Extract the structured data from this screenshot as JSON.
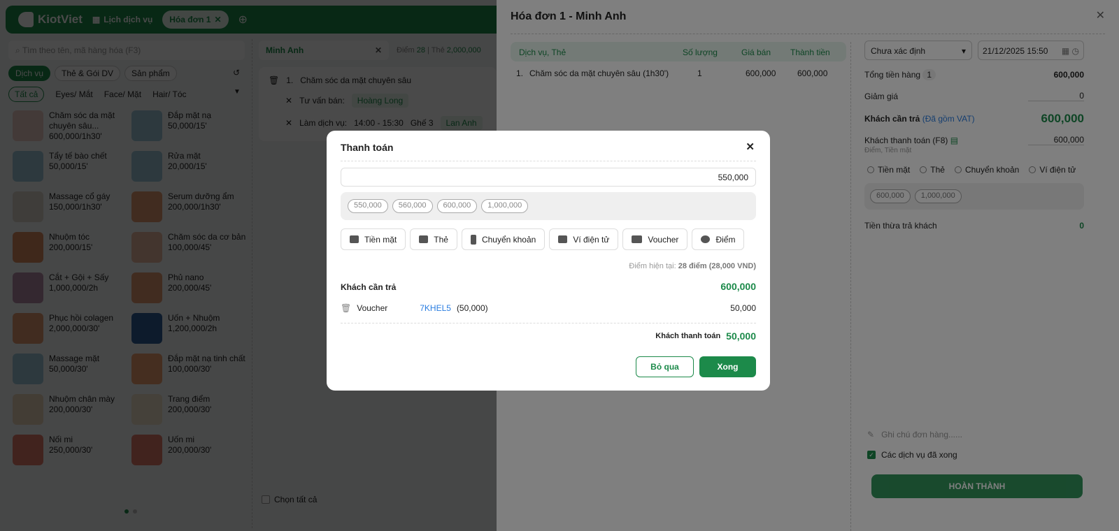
{
  "topbar": {
    "brand": "KiotViet",
    "tab_calendar": "Lịch dịch vụ",
    "tab_invoice": "Hóa đơn 1"
  },
  "search": {
    "placeholder": "Tìm theo tên, mã hàng hóa (F3)"
  },
  "type_chips": [
    "Dịch vụ",
    "Thẻ & Gói DV",
    "Sản phẩm"
  ],
  "categories": [
    "Tất cả",
    "Eyes/ Mắt",
    "Face/ Mặt",
    "Hair/ Tóc"
  ],
  "products": [
    {
      "name": "Chăm sóc da mặt chuyên sâu...",
      "price": "600,000/1h30'",
      "color": "#e9c9c2"
    },
    {
      "name": "Đắp mặt nạ",
      "price": "50,000/15'",
      "color": "#9cc6d8"
    },
    {
      "name": "Tẩy tế bào chết",
      "price": "50,000/15'",
      "color": "#9cc6d8"
    },
    {
      "name": "Rửa mặt",
      "price": "20,000/15'",
      "color": "#9cc6d8"
    },
    {
      "name": "Massage cổ gáy",
      "price": "150,000/1h30'",
      "color": "#d9d2c8"
    },
    {
      "name": "Serum dưỡng ẩm",
      "price": "200,000/1h30'",
      "color": "#e09a6e"
    },
    {
      "name": "Nhuộm tóc",
      "price": "200,000/15'",
      "color": "#d98a5e"
    },
    {
      "name": "Chăm sóc da cơ bản",
      "price": "100,000/45'",
      "color": "#e8b9a0"
    },
    {
      "name": "Cắt + Gội + Sấy",
      "price": "1,000,000/2h",
      "color": "#b48aa8"
    },
    {
      "name": "Phủ nano",
      "price": "200,000/45'",
      "color": "#e09a6e"
    },
    {
      "name": "Phục hồi colagen",
      "price": "2,000,000/30'",
      "color": "#e09a6e"
    },
    {
      "name": "Uốn + Nhuộm",
      "price": "1,200,000/2h",
      "color": "#2f5d9a"
    },
    {
      "name": "Massage mặt",
      "price": "50,000/30'",
      "color": "#9cc6d8"
    },
    {
      "name": "Đắp mặt nạ tinh chất",
      "price": "100,000/30'",
      "color": "#f0a070"
    },
    {
      "name": "Nhuộm chân mày",
      "price": "200,000/30'",
      "color": "#e8d2b8"
    },
    {
      "name": "Trang điểm",
      "price": "200,000/30'",
      "color": "#eee0c8"
    },
    {
      "name": "Nối mi",
      "price": "250,000/30'",
      "color": "#e07a6a"
    },
    {
      "name": "Uốn mi",
      "price": "200,000/30'",
      "color": "#e07a6a"
    }
  ],
  "customer": {
    "name": "Minh Anh",
    "points_label": "Điểm",
    "points": "28",
    "card_label": "Thẻ",
    "card": "2,000,000"
  },
  "order": {
    "index": "1.",
    "service": "Chăm sóc da mặt chuyên sâu",
    "advisor_label": "Tư vấn bán:",
    "advisor": "Hoàng Long",
    "work_label": "Làm dịch vụ:",
    "time": "14:00 - 15:30",
    "seat": "Ghế 3",
    "staff": "Lan Anh"
  },
  "select_all": "Chọn tất cả",
  "drawer": {
    "title": "Hóa đơn 1 - Minh Anh",
    "columns": [
      "Dịch vụ, Thẻ",
      "Số lượng",
      "Giá bán",
      "Thành tiền"
    ],
    "row": {
      "index": "1.",
      "name": "Chăm sóc da mặt chuyên sâu (1h30')",
      "qty": "1",
      "price": "600,000",
      "total": "600,000"
    },
    "staff_select": "Chưa xác định",
    "datetime": "21/12/2025 15:50",
    "subtotal_label": "Tổng tiền hàng",
    "subtotal_count": "1",
    "subtotal": "600,000",
    "discount_label": "Giảm giá",
    "discount": "0",
    "due_label": "Khách cần trả",
    "vat_note": "(Đã gồm VAT)",
    "due": "600,000",
    "paid_label": "Khách thanh toán (F8)",
    "paid": "600,000",
    "paid_methods": "Điểm, Tiền mặt",
    "methods": [
      "Tiền mặt",
      "Thẻ",
      "Chuyển khoản",
      "Ví điện tử"
    ],
    "quick": [
      "600,000",
      "1,000,000"
    ],
    "change_label": "Tiền thừa trả khách",
    "change": "0",
    "note_placeholder": "Ghi chú đơn hàng......",
    "services_done": "Các dịch vụ đã xong",
    "finish": "HOÀN THÀNH"
  },
  "modal": {
    "title": "Thanh toán",
    "amount": "550,000",
    "quick": [
      "550,000",
      "560,000",
      "600,000",
      "1,000,000"
    ],
    "methods": [
      "Tiền mặt",
      "Thẻ",
      "Chuyển khoản",
      "Ví điện tử",
      "Voucher",
      "Điểm"
    ],
    "points_label": "Điểm hiện tại:",
    "points_value": "28 điểm (28,000 VND)",
    "due_label": "Khách cần trả",
    "due": "600,000",
    "voucher_label": "Voucher",
    "voucher_code": "7KHEL5",
    "voucher_amount_note": "(50,000)",
    "voucher_amount": "50,000",
    "paid_label": "Khách thanh toán",
    "paid": "50,000",
    "cancel": "Bỏ qua",
    "confirm": "Xong"
  },
  "colors": {
    "brand": "#1c8a4a",
    "link": "#2a7de1"
  }
}
